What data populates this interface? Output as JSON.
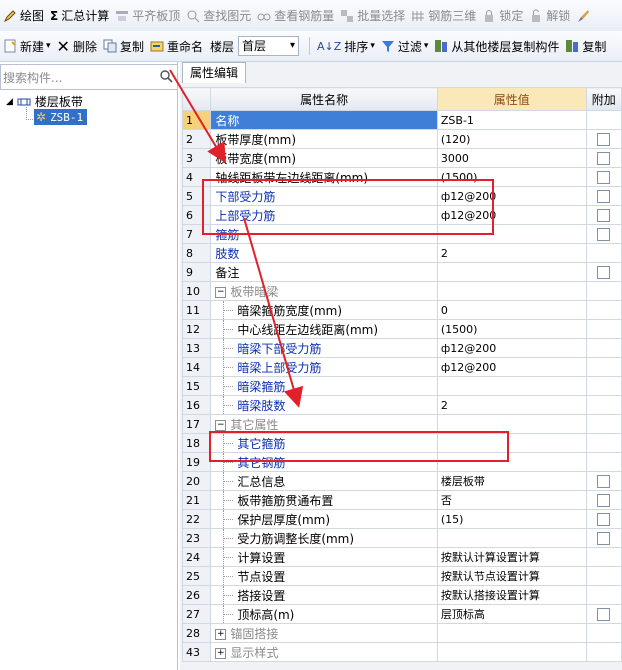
{
  "toolbar1": {
    "draw": "绘图",
    "sum": "汇总计算",
    "align": "平齐板顶",
    "find": "查找图元",
    "view_rebar": "查看钢筋量",
    "batch_select": "批量选择",
    "rebar_3d": "钢筋三维",
    "lock": "锁定",
    "unlock": "解锁"
  },
  "toolbar2": {
    "new": "新建",
    "delete": "删除",
    "copy": "复制",
    "rename": "重命名",
    "floor_label": "楼层",
    "floor_value": "首层",
    "sort": "排序",
    "filter": "过滤",
    "copy_from_floor": "从其他楼层复制构件",
    "copy2": "复制"
  },
  "left": {
    "search_placeholder": "搜索构件...",
    "tree_root": "楼层板带",
    "tree_child": "ZSB-1"
  },
  "right": {
    "tab": "属性编辑",
    "headers": {
      "name": "属性名称",
      "value": "属性值",
      "extra": "附加"
    },
    "rows": [
      {
        "n": "1",
        "name": "名称",
        "value": "ZSB-1",
        "style": "blue",
        "chk": false,
        "indent": 0,
        "sel": true
      },
      {
        "n": "2",
        "name": "板带厚度(mm)",
        "value": "(120)",
        "style": "",
        "chk": true,
        "indent": 0
      },
      {
        "n": "3",
        "name": "板带宽度(mm)",
        "value": "3000",
        "style": "",
        "chk": true,
        "indent": 0
      },
      {
        "n": "4",
        "name": "轴线距板带左边线距离(mm)",
        "value": "(1500)",
        "style": "",
        "chk": true,
        "indent": 0
      },
      {
        "n": "5",
        "name": "下部受力筋",
        "value": "ф12@200",
        "style": "blue",
        "chk": true,
        "indent": 0
      },
      {
        "n": "6",
        "name": "上部受力筋",
        "value": "ф12@200",
        "style": "blue",
        "chk": true,
        "indent": 0
      },
      {
        "n": "7",
        "name": "箍筋",
        "value": "",
        "style": "blue",
        "chk": true,
        "indent": 0
      },
      {
        "n": "8",
        "name": "肢数",
        "value": "2",
        "style": "blue",
        "chk": false,
        "indent": 0
      },
      {
        "n": "9",
        "name": "备注",
        "value": "",
        "style": "",
        "chk": true,
        "indent": 0
      },
      {
        "n": "10",
        "name": "板带暗梁",
        "value": "",
        "style": "grp",
        "chk": false,
        "indent": 0,
        "pm": "−"
      },
      {
        "n": "11",
        "name": "暗梁箍筋宽度(mm)",
        "value": "0",
        "style": "",
        "chk": false,
        "indent": 1
      },
      {
        "n": "12",
        "name": "中心线距左边线距离(mm)",
        "value": "(1500)",
        "style": "",
        "chk": false,
        "indent": 1
      },
      {
        "n": "13",
        "name": "暗梁下部受力筋",
        "value": "ф12@200",
        "style": "blue",
        "chk": false,
        "indent": 1
      },
      {
        "n": "14",
        "name": "暗梁上部受力筋",
        "value": "ф12@200",
        "style": "blue",
        "chk": false,
        "indent": 1
      },
      {
        "n": "15",
        "name": "暗梁箍筋",
        "value": "",
        "style": "blue",
        "chk": false,
        "indent": 1
      },
      {
        "n": "16",
        "name": "暗梁肢数",
        "value": "2",
        "style": "blue",
        "chk": false,
        "indent": 1
      },
      {
        "n": "17",
        "name": "其它属性",
        "value": "",
        "style": "grp",
        "chk": false,
        "indent": 0,
        "pm": "−"
      },
      {
        "n": "18",
        "name": "其它箍筋",
        "value": "",
        "style": "blue",
        "chk": false,
        "indent": 1
      },
      {
        "n": "19",
        "name": "其它钢筋",
        "value": "",
        "style": "blue",
        "chk": false,
        "indent": 1
      },
      {
        "n": "20",
        "name": "汇总信息",
        "value": "楼层板带",
        "style": "",
        "chk": true,
        "indent": 1
      },
      {
        "n": "21",
        "name": "板带箍筋贯通布置",
        "value": "否",
        "style": "",
        "chk": true,
        "indent": 1
      },
      {
        "n": "22",
        "name": "保护层厚度(mm)",
        "value": "(15)",
        "style": "",
        "chk": true,
        "indent": 1
      },
      {
        "n": "23",
        "name": "受力筋调整长度(mm)",
        "value": "",
        "style": "",
        "chk": true,
        "indent": 1
      },
      {
        "n": "24",
        "name": "计算设置",
        "value": "按默认计算设置计算",
        "style": "",
        "chk": false,
        "indent": 1
      },
      {
        "n": "25",
        "name": "节点设置",
        "value": "按默认节点设置计算",
        "style": "",
        "chk": false,
        "indent": 1
      },
      {
        "n": "26",
        "name": "搭接设置",
        "value": "按默认搭接设置计算",
        "style": "",
        "chk": false,
        "indent": 1
      },
      {
        "n": "27",
        "name": "顶标高(m)",
        "value": "层顶标高",
        "style": "",
        "chk": true,
        "indent": 1
      },
      {
        "n": "28",
        "name": "锚固搭接",
        "value": "",
        "style": "grp",
        "chk": false,
        "indent": 0,
        "pm": "+"
      },
      {
        "n": "43",
        "name": "显示样式",
        "value": "",
        "style": "grp",
        "chk": false,
        "indent": 0,
        "pm": "+"
      }
    ]
  },
  "colors": {
    "annotation": "#e0202a",
    "selection": "#3f7fd8",
    "value_header": "#fbe8b8"
  }
}
